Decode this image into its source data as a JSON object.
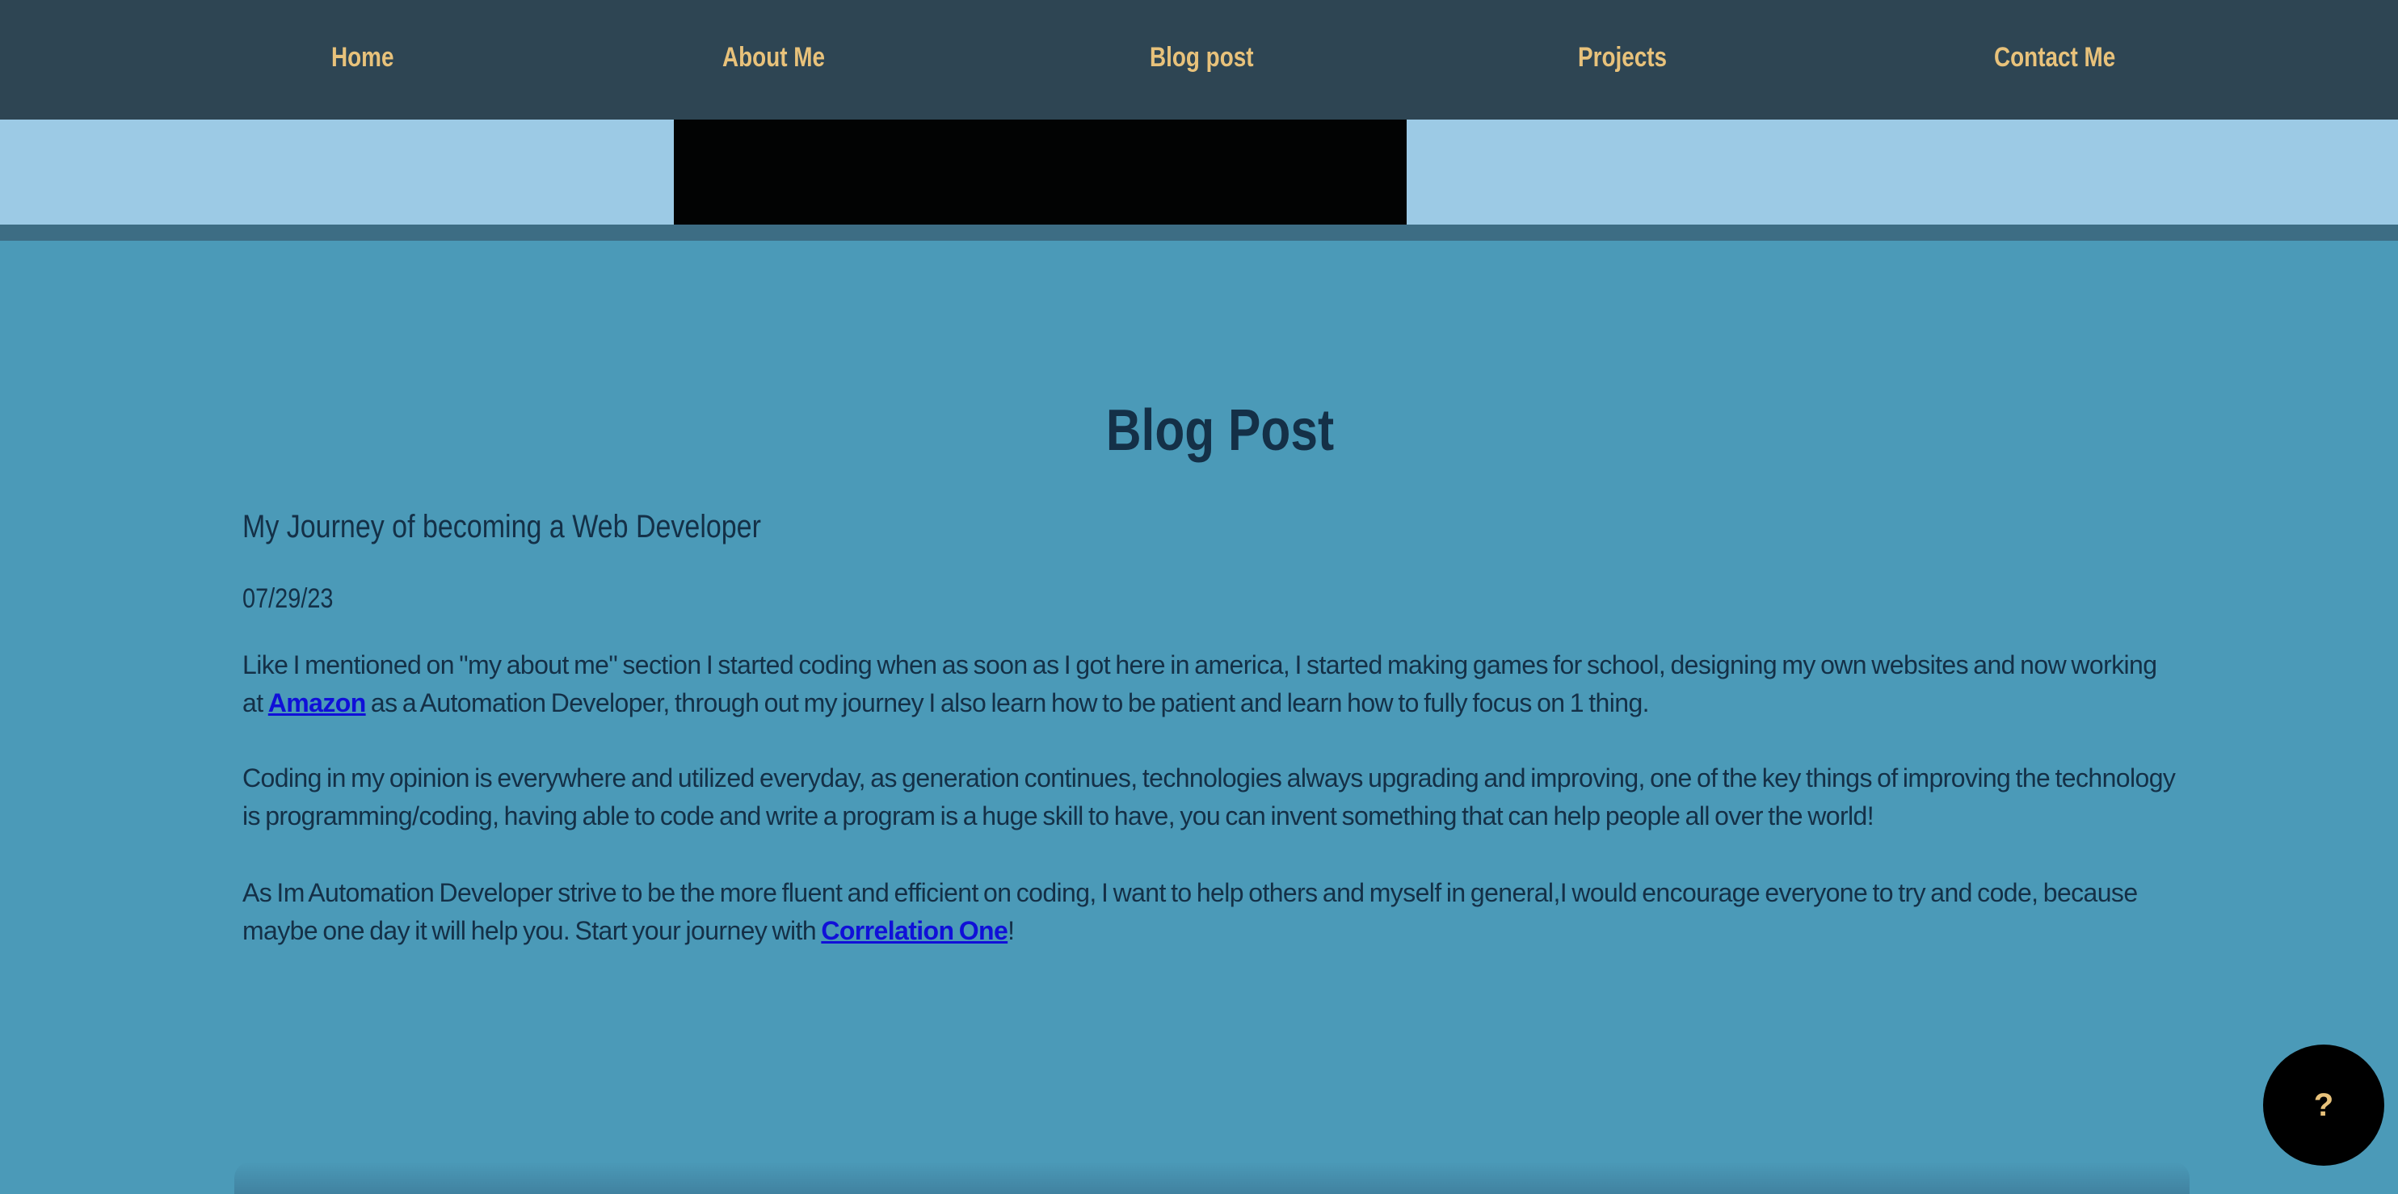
{
  "nav": {
    "items": [
      {
        "label": "Home"
      },
      {
        "label": "About Me"
      },
      {
        "label": "Blog post"
      },
      {
        "label": "Projects"
      },
      {
        "label": "Contact Me"
      }
    ]
  },
  "main": {
    "page_title": "Blog Post",
    "post_title": "My Journey of becoming a Web Developer",
    "post_date": "07/29/23",
    "paragraph1": {
      "before_link": "    Like I mentioned on \"my about me\" section I started coding when as soon as I got here in america, I started making games for school, designing my own websites and now working at ",
      "link_text": "Amazon",
      "after_link": " as a Automation Developer, through out my journey I also learn how to be patient and learn how to fully focus on 1 thing."
    },
    "paragraph2": "Coding in my opinion is everywhere and utilized everyday, as generation continues, technologies always upgrading and improving, one of the key things of improving the technology is programming/coding, having able to code and write a program is a huge skill to have, you can invent something that can help people all over the world!",
    "paragraph3": {
      "before_link": "As Im Automation Developer strive to be the more fluent and efficient on coding, I want to help others and myself in general,I would encourage everyone to try and code, because maybe one day it will help you. Start your journey with ",
      "link_text": "Correlation One",
      "after_link": "!"
    }
  },
  "help_button": {
    "label": "?"
  },
  "colors": {
    "navbar_bg": "#2e4553",
    "nav_text": "#e8c27b",
    "banner_bg": "#9ccae5",
    "content_bg": "#4b9ab8",
    "heading_text": "#143047",
    "link": "#1010d8"
  }
}
